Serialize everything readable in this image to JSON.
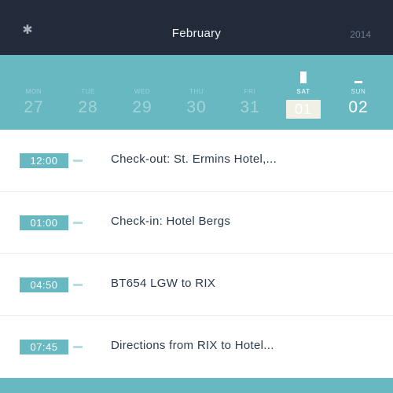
{
  "header": {
    "menu_icon": "asterisk-icon",
    "month": "February",
    "year": "2014"
  },
  "week": {
    "days": [
      {
        "dow": "MON",
        "num": "27"
      },
      {
        "dow": "TUE",
        "num": "28"
      },
      {
        "dow": "WED",
        "num": "29"
      },
      {
        "dow": "THU",
        "num": "30"
      },
      {
        "dow": "FRI",
        "num": "31"
      },
      {
        "dow": "SAT",
        "num": "01"
      },
      {
        "dow": "SUN",
        "num": "02"
      }
    ],
    "selected_index": 5
  },
  "events": [
    {
      "time": "12:00",
      "title": "Check-out: St. Ermins Hotel,..."
    },
    {
      "time": "01:00",
      "title": "Check-in: Hotel Bergs"
    },
    {
      "time": "04:50",
      "title": "BT654 LGW to RIX"
    },
    {
      "time": "07:45",
      "title": "Directions from RIX to Hotel..."
    }
  ],
  "colors": {
    "header_bg": "#232b3b",
    "accent": "#68b8c2",
    "selected_day_bg": "#f2efe4",
    "event_text": "#2b3b4e"
  }
}
